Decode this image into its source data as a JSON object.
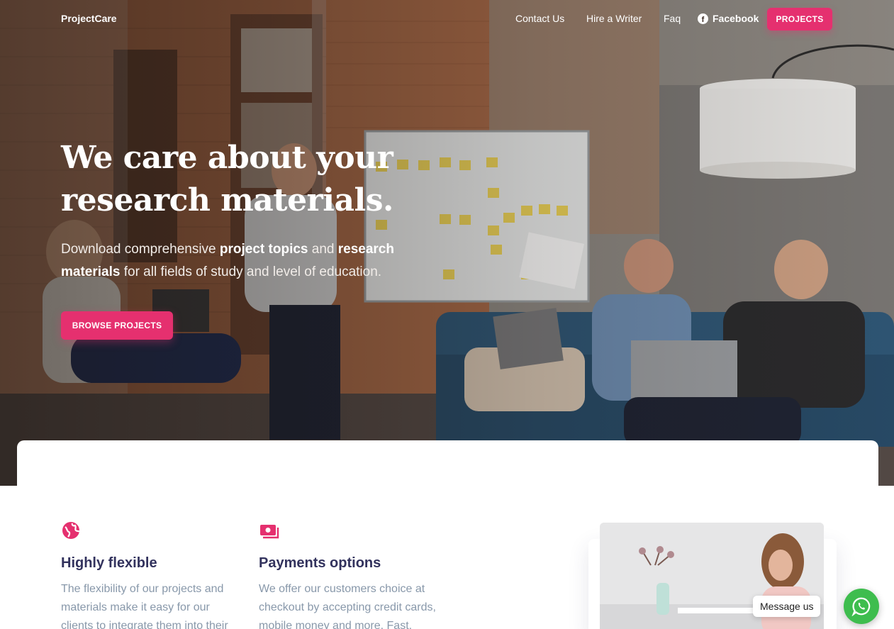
{
  "nav": {
    "brand": "ProjectCare",
    "links": [
      "Contact Us",
      "Hire a Writer",
      "Faq",
      "Facebook"
    ],
    "cta": "PROJECTS"
  },
  "hero": {
    "headline_line1": "We care about your",
    "headline_line2": "research materials.",
    "sub_1": "Download comprehensive ",
    "sub_bold_1": "project topics",
    "sub_2": " and ",
    "sub_bold_2": "research materials",
    "sub_3": " for all fields of study and level of education.",
    "cta": "BROWSE PROJECTS"
  },
  "features": [
    {
      "icon": "globe-icon",
      "title": "Highly flexible",
      "text": "The flexibility of our projects and materials make it easy for our clients to integrate them into their"
    },
    {
      "icon": "money-icon",
      "title": "Payments options",
      "text": "We offer our customers choice at checkout by accepting credit cards, mobile money and more. Fast,"
    }
  ],
  "chat": {
    "label": "Message us",
    "icon": "whatsapp-icon"
  },
  "colors": {
    "accent": "#e5306f",
    "heading": "#32325d",
    "muted": "#8898aa",
    "whatsapp": "#3ebd4e"
  }
}
